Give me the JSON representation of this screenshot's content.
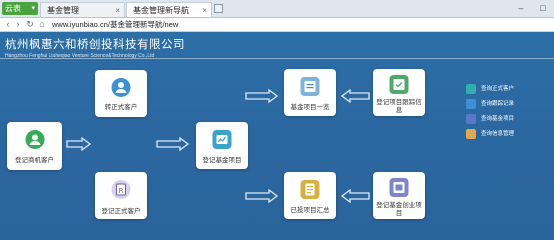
{
  "browser": {
    "app_button": "云表",
    "tabs": [
      {
        "label": "基金管理"
      },
      {
        "label": "基金管理新导航"
      }
    ],
    "url": "www.iyunbiao.cn/基金管理新导航/new"
  },
  "header": {
    "company_cn": "杭州枫惠六和桥创投科技有限公司",
    "company_en": "Hangzhou Fenghui Liuheqiao Venture Science&Technology Co.,Ltd"
  },
  "flow": {
    "register_lead": "登记商机客户",
    "to_formal": "转正式客户",
    "register_formal": "登记正式客户",
    "register_fund": "登记基金项目",
    "fund_list": "基金项目一览",
    "track_info": "登记项目跟踪信息",
    "invested_summary": "已投项目汇总",
    "register_fund_company": "登记基金创业项目"
  },
  "legend": [
    {
      "label": "查询正式客户",
      "color": "#2fb0a8"
    },
    {
      "label": "查询跟踪记录",
      "color": "#3d8fd6"
    },
    {
      "label": "查询基金项目",
      "color": "#5a78c8"
    },
    {
      "label": "查询信息管理",
      "color": "#e0a94e"
    }
  ]
}
